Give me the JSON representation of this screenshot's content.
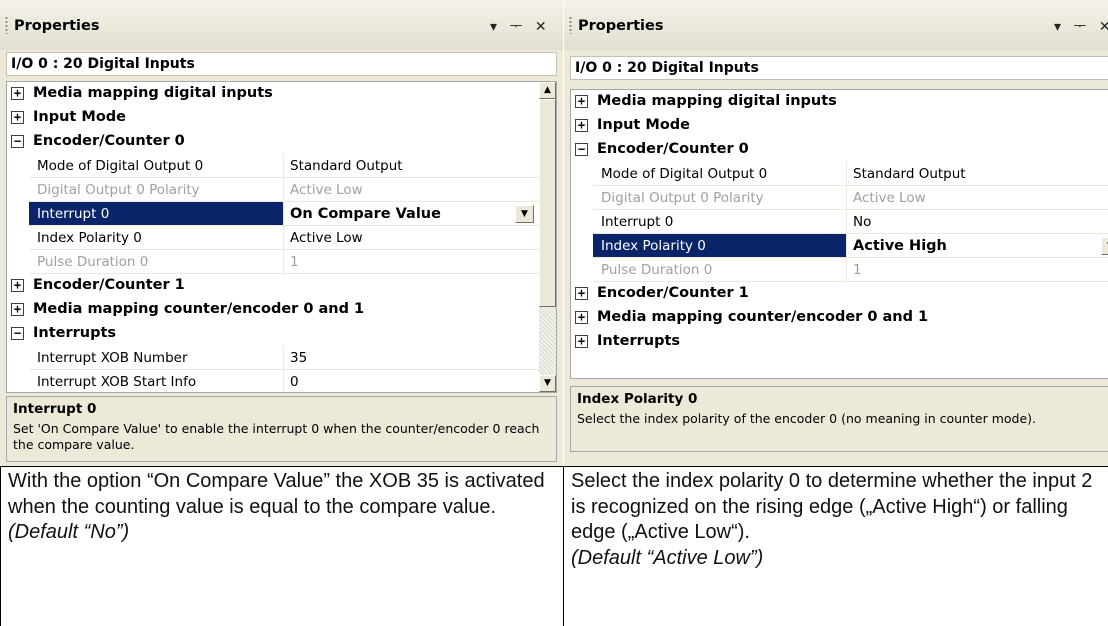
{
  "left_panel": {
    "title": "Properties",
    "titlebar_icons": [
      "▾",
      "ᅮ",
      "✕"
    ],
    "object_name": "I/O 0 : 20 Digital Inputs",
    "categories": {
      "media_mapping_digital_inputs": "Media mapping digital inputs",
      "input_mode": "Input Mode",
      "encoder_counter_0": "Encoder/Counter 0",
      "encoder_counter_1": "Encoder/Counter 1",
      "media_mapping_counter": "Media mapping counter/encoder 0 and 1",
      "interrupts": "Interrupts"
    },
    "encoder0_props": [
      {
        "name": "Mode of Digital Output 0",
        "value": "Standard Output"
      },
      {
        "name": "Digital Output 0 Polarity",
        "value": "Active Low"
      },
      {
        "name": "Interrupt 0",
        "value": "On Compare Value"
      },
      {
        "name": "Index Polarity 0",
        "value": "Active Low"
      },
      {
        "name": "Pulse Duration 0",
        "value": "1"
      }
    ],
    "interrupt_props": [
      {
        "name": "Interrupt XOB Number",
        "value": "35"
      },
      {
        "name": "Interrupt XOB Start Info",
        "value": "0"
      }
    ],
    "description": {
      "title": "Interrupt 0",
      "text": "Set 'On Compare Value' to enable the interrupt 0 when the counter/encoder 0 reach the compare value."
    }
  },
  "right_panel": {
    "title": "Properties",
    "titlebar_icons": [
      "▾",
      "ᅮ",
      "✕"
    ],
    "object_name": "I/O 0 : 20 Digital Inputs",
    "categories": {
      "media_mapping_digital_inputs": "Media mapping digital inputs",
      "input_mode": "Input Mode",
      "encoder_counter_0": "Encoder/Counter 0",
      "encoder_counter_1": "Encoder/Counter 1",
      "media_mapping_counter": "Media mapping counter/encoder 0 and 1",
      "interrupts": "Interrupts"
    },
    "encoder0_props": [
      {
        "name": "Mode of Digital Output 0",
        "value": "Standard Output"
      },
      {
        "name": "Digital Output 0 Polarity",
        "value": "Active Low"
      },
      {
        "name": "Interrupt 0",
        "value": "No"
      },
      {
        "name": "Index Polarity 0",
        "value": "Active High"
      },
      {
        "name": "Pulse Duration 0",
        "value": "1"
      }
    ],
    "description": {
      "title": "Index Polarity 0",
      "text": "Select the index polarity of the encoder 0 (no meaning in counter mode)."
    }
  },
  "expander_glyphs": {
    "collapsed": "+",
    "expanded": "−"
  },
  "scroll_glyphs": {
    "up": "▲",
    "down": "▼"
  },
  "dropdown_glyph": "▼",
  "captions": {
    "left": {
      "text": "With the option “On Compare Value” the XOB 35 is activated when the counting value is equal to the compare value.",
      "default": "(Default “No”)"
    },
    "right": {
      "text": "Select the index polarity 0 to determine whether the input 2 is recognized on the rising edge („Active High“) or falling edge („Active Low“).",
      "default": "(Default “Active Low”)"
    }
  },
  "colors": {
    "selection": "#0a246a",
    "panel_bg": "#ece9d8",
    "disabled_text": "#a0a0a0"
  }
}
